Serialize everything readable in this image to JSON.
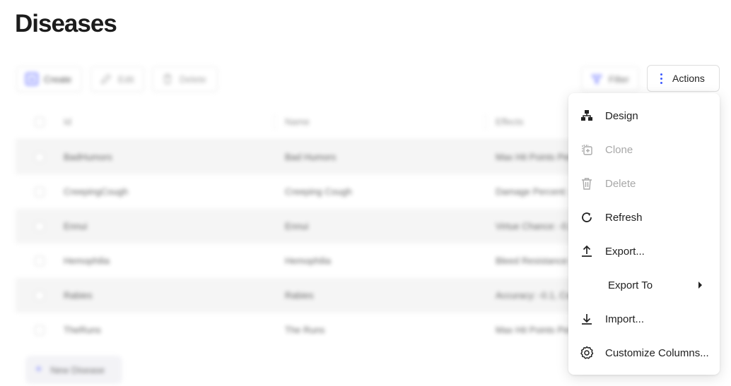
{
  "page": {
    "title": "Diseases"
  },
  "toolbar": {
    "create_label": "Create",
    "edit_label": "Edit",
    "delete_label": "Delete",
    "filter_label": "Filter",
    "actions_label": "Actions"
  },
  "table": {
    "headers": [
      "Id",
      "Name",
      "Effects"
    ],
    "rows": [
      {
        "id": "BadHumors",
        "name": "Bad Humors",
        "effects": "Max Hit Points Perc"
      },
      {
        "id": "CreepingCough",
        "name": "Creeping Cough",
        "effects": "Damage Percent: -"
      },
      {
        "id": "Ennui",
        "name": "Ennui",
        "effects": "Virtue Chance: -0.1"
      },
      {
        "id": "Hemophilia",
        "name": "Hemophilia",
        "effects": "Bleed Resistance: -"
      },
      {
        "id": "Rabies",
        "name": "Rabies",
        "effects": "Accuracy: -0.1, Cor"
      },
      {
        "id": "TheRuns",
        "name": "The Runs",
        "effects": "Max Hit Points Perc"
      }
    ],
    "new_label": "New Disease"
  },
  "menu": {
    "items": [
      {
        "label": "Design",
        "icon": "sitemap-icon",
        "enabled": true
      },
      {
        "label": "Clone",
        "icon": "clone-icon",
        "enabled": false
      },
      {
        "label": "Delete",
        "icon": "trash-icon",
        "enabled": false
      },
      {
        "label": "Refresh",
        "icon": "refresh-icon",
        "enabled": true
      },
      {
        "label": "Export...",
        "icon": "upload-icon",
        "enabled": true
      },
      {
        "label": "Export To",
        "icon": "caret-right-icon",
        "enabled": true
      },
      {
        "label": "Import...",
        "icon": "download-icon",
        "enabled": true
      },
      {
        "label": "Customize Columns...",
        "icon": "gear-icon",
        "enabled": true
      }
    ]
  },
  "colors": {
    "accent": "#3d5afe",
    "disabled": "#a8a8a8"
  }
}
